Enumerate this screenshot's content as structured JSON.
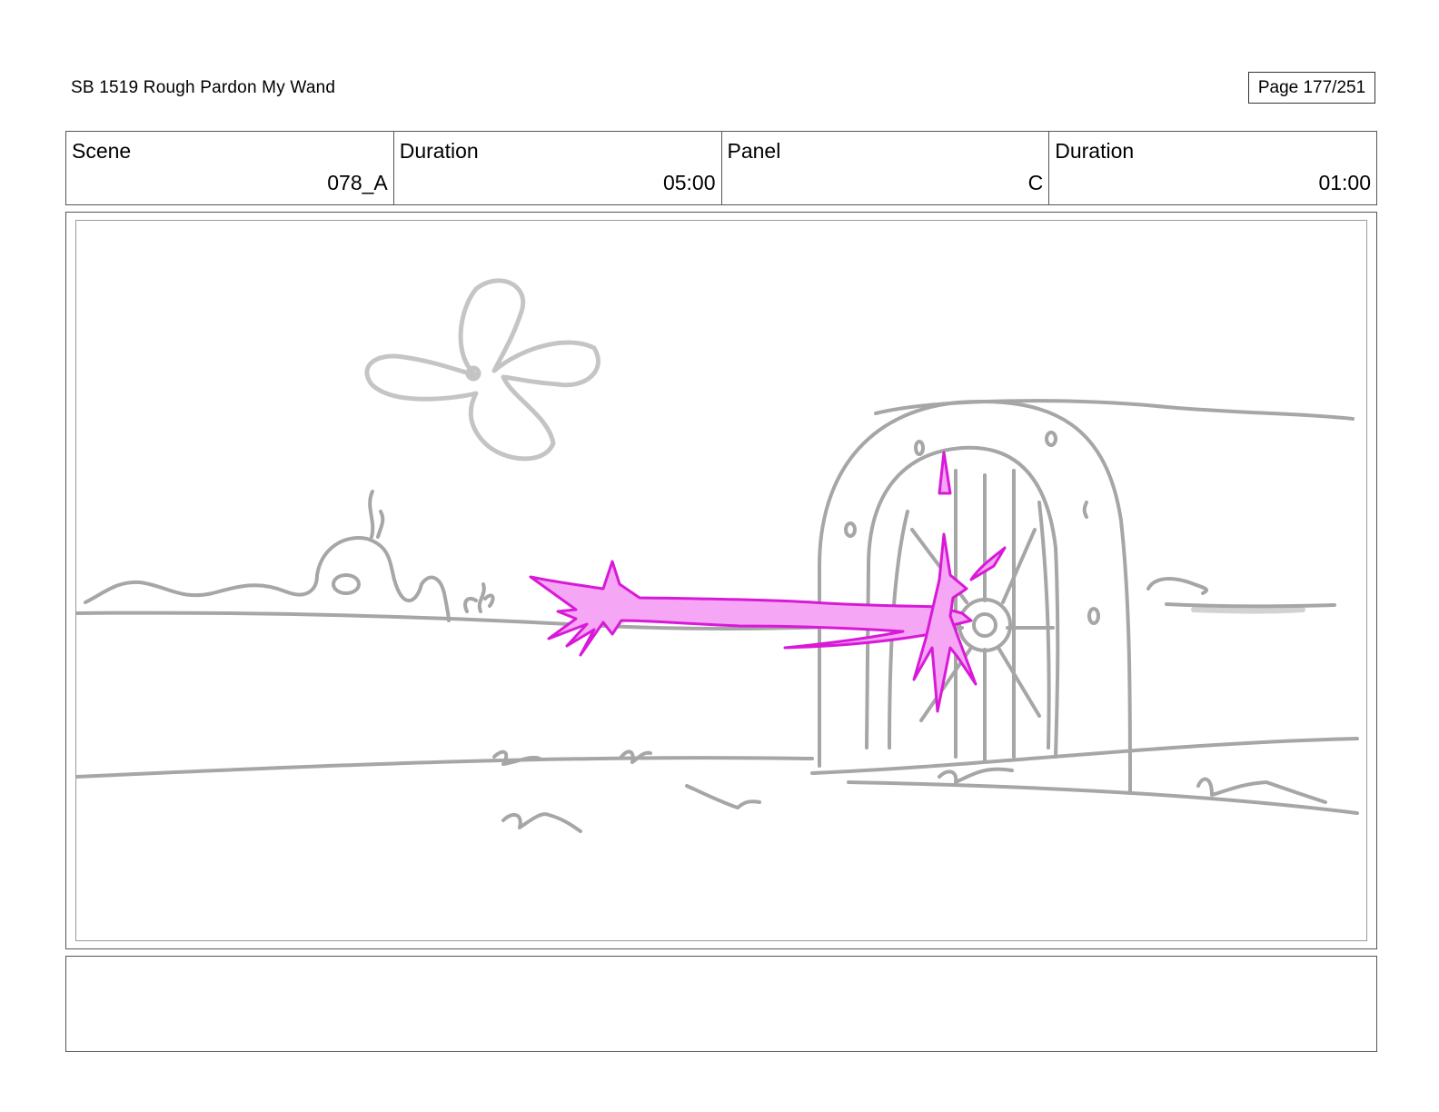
{
  "header": {
    "title": "SB 1519 Rough  Pardon My Wand",
    "page": "Page 177/251"
  },
  "info": {
    "scene_label": "Scene",
    "scene_value": "078_A",
    "scene_duration_label": "Duration",
    "scene_duration_value": "05:00",
    "panel_label": "Panel",
    "panel_value": "C",
    "panel_duration_label": "Duration",
    "panel_duration_value": "01:00"
  },
  "drawing": {
    "sketch_color": "#a6a6a6",
    "magic_fill": "#f5a6f5",
    "magic_stroke": "#d81ad8"
  },
  "notes": {
    "text": ""
  }
}
